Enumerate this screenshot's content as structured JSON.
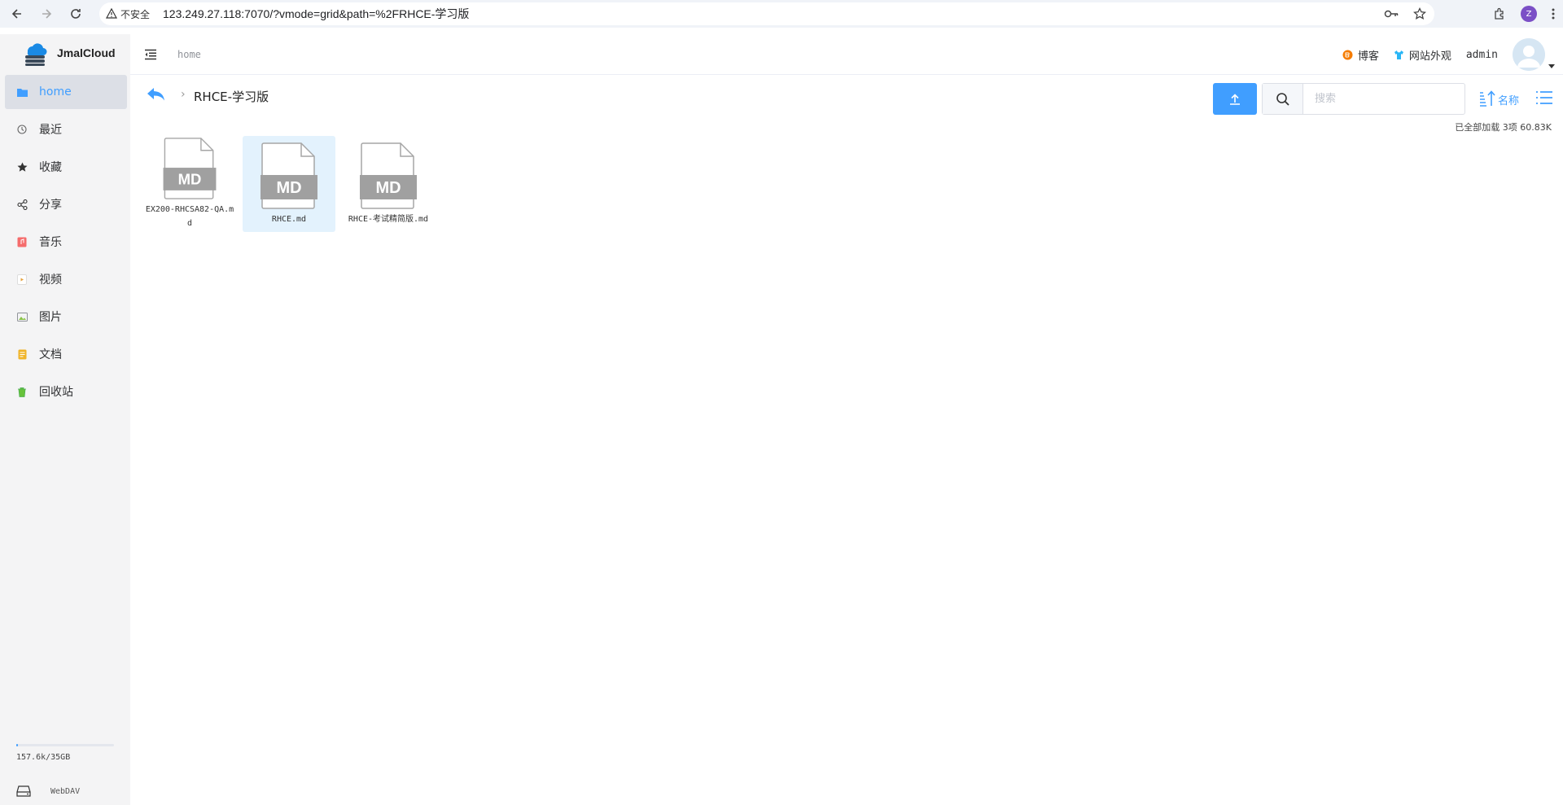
{
  "browser": {
    "insecure_label": "不安全",
    "url": "123.249.27.118:7070/?vmode=grid&path=%2FRHCE-学习版",
    "profile_initial": "Z"
  },
  "app": {
    "brand": "JmalCloud"
  },
  "sidebar": {
    "items": [
      {
        "label": "home",
        "icon": "folder-icon",
        "color": "#409eff"
      },
      {
        "label": "最近",
        "icon": "clock-icon",
        "color": "#666666"
      },
      {
        "label": "收藏",
        "icon": "star-icon",
        "color": "#333333"
      },
      {
        "label": "分享",
        "icon": "share-icon",
        "color": "#333333"
      },
      {
        "label": "音乐",
        "icon": "music-icon",
        "color": "#f56c6c"
      },
      {
        "label": "视频",
        "icon": "video-icon",
        "color": "#e6a23c"
      },
      {
        "label": "图片",
        "icon": "image-icon",
        "color": "#909399"
      },
      {
        "label": "文档",
        "icon": "document-icon",
        "color": "#f0b429"
      },
      {
        "label": "回收站",
        "icon": "trash-icon",
        "color": "#67c23a"
      }
    ],
    "storage": "157.6k/35GB",
    "storage_fraction": 0.02,
    "webdav": "WebDAV"
  },
  "header": {
    "crumb": "home",
    "blog": "博客",
    "appearance": "网站外观",
    "username": "admin"
  },
  "toolbar": {
    "current_folder": "RHCE-学习版",
    "search_placeholder": "搜索",
    "sort_label": "名称",
    "summary": "已全部加载 3项 60.83K"
  },
  "files": [
    {
      "name": "EX200-RHCSA82-QA.md",
      "badge": "MD"
    },
    {
      "name": "RHCE.md",
      "badge": "MD"
    },
    {
      "name": "RHCE-考试精简版.md",
      "badge": "MD"
    }
  ]
}
